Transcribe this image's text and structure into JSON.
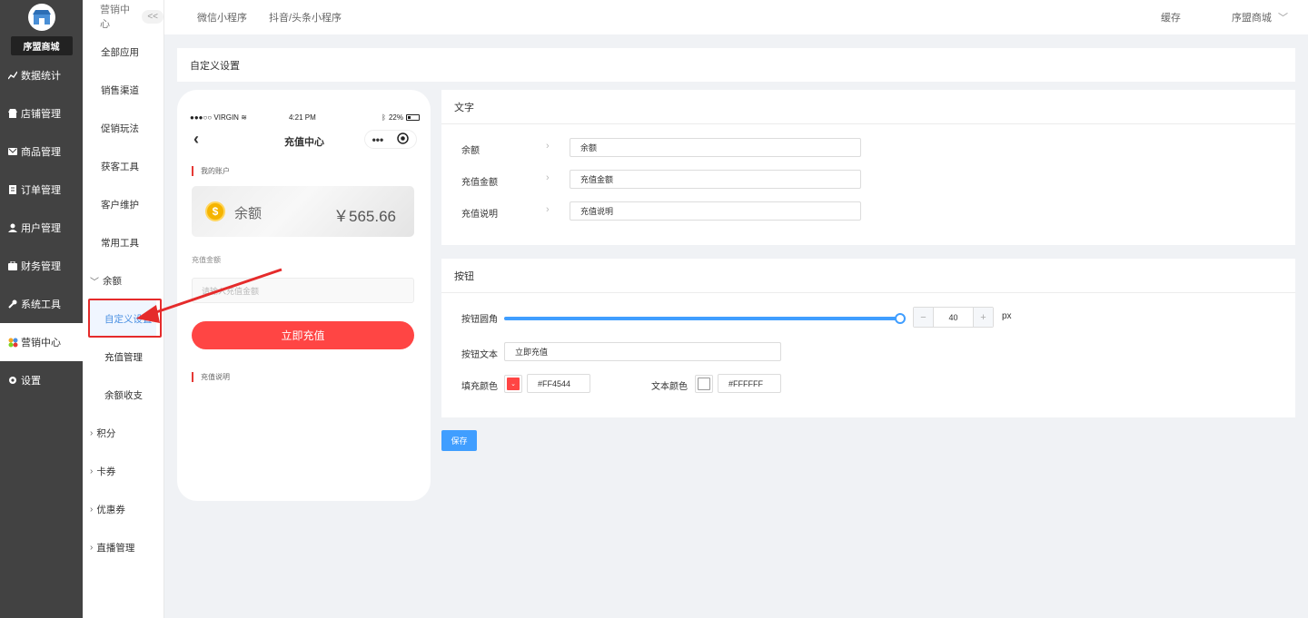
{
  "brand": {
    "name": "序盟商城"
  },
  "sidebar": {
    "items": [
      {
        "label": "数据统计",
        "icon": "chart-icon"
      },
      {
        "label": "店铺管理",
        "icon": "store-icon"
      },
      {
        "label": "商品管理",
        "icon": "goods-icon"
      },
      {
        "label": "订单管理",
        "icon": "order-icon"
      },
      {
        "label": "用户管理",
        "icon": "user-icon"
      },
      {
        "label": "财务管理",
        "icon": "finance-icon"
      },
      {
        "label": "系统工具",
        "icon": "wrench-icon"
      },
      {
        "label": "营销中心",
        "icon": "marketing-icon",
        "active": true
      },
      {
        "label": "设置",
        "icon": "gear-icon"
      }
    ]
  },
  "submenu": {
    "title": "营销中心",
    "collapse": "<<",
    "items": [
      "全部应用",
      "销售渠道",
      "促销玩法",
      "获客工具",
      "客户维护",
      "常用工具"
    ],
    "groups": {
      "balance": "余额",
      "balance_children": [
        "自定义设置",
        "充值管理",
        "余额收支"
      ],
      "others": [
        "积分",
        "卡券",
        "优惠券",
        "直播管理"
      ]
    }
  },
  "topbar": {
    "tabs": [
      "微信小程序",
      "抖音/头条小程序"
    ],
    "cache": "缓存",
    "store": "序盟商城"
  },
  "page": {
    "title": "自定义设置"
  },
  "phone": {
    "carrier": "●●●○○ VIRGIN",
    "time": "4:21 PM",
    "battery": "22%",
    "nav_title": "充值中心",
    "account_label": "我的账户",
    "balance_label": "余额",
    "balance_value": "￥565.66",
    "amount_label": "充值金额",
    "amount_placeholder": "请输入充值金额",
    "charge_button": "立即充值",
    "desc_label": "充值说明"
  },
  "text_panel": {
    "title": "文字",
    "rows": [
      {
        "label": "余额",
        "value": "余额"
      },
      {
        "label": "充值金额",
        "value": "充值金额"
      },
      {
        "label": "充值说明",
        "value": "充值说明"
      }
    ]
  },
  "button_panel": {
    "title": "按钮",
    "radius_label": "按钮圆角",
    "radius_value": "40",
    "radius_fraction": 1.0,
    "unit": "px",
    "minus": "−",
    "plus": "+",
    "text_label": "按钮文本",
    "text_value": "立即充值",
    "fill_label": "填充颜色",
    "fill_color": "#FF4544",
    "text_color_label": "文本颜色",
    "text_color": "#FFFFFF"
  },
  "save_button": "保存"
}
